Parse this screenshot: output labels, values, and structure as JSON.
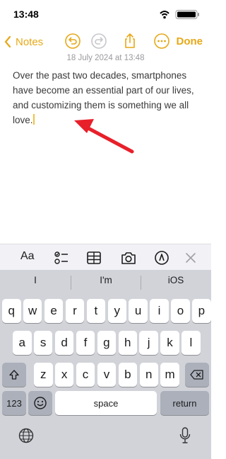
{
  "status": {
    "time": "13:48"
  },
  "nav": {
    "back_label": "Notes",
    "done_label": "Done"
  },
  "note": {
    "date": "18 July 2024 at 13:48",
    "body": "Over the past two decades, smartphones have become an essential part of our lives, and customizing them is something we all love."
  },
  "toolbar": {
    "text_format_label": "Aa",
    "items": [
      "text-format",
      "checklist",
      "table",
      "camera",
      "markup",
      "close"
    ]
  },
  "keyboard": {
    "suggestions": [
      "I",
      "I'm",
      "iOS"
    ],
    "row1": [
      "q",
      "w",
      "e",
      "r",
      "t",
      "y",
      "u",
      "i",
      "o",
      "p"
    ],
    "row2": [
      "a",
      "s",
      "d",
      "f",
      "g",
      "h",
      "j",
      "k",
      "l"
    ],
    "row3": [
      "z",
      "x",
      "c",
      "v",
      "b",
      "n",
      "m"
    ],
    "numbers_label": "123",
    "space_label": "space",
    "return_label": "return"
  },
  "colors": {
    "accent": "#e6a817",
    "annotation_arrow": "#e8202a",
    "keyboard_bg": "#d1d3d9"
  }
}
